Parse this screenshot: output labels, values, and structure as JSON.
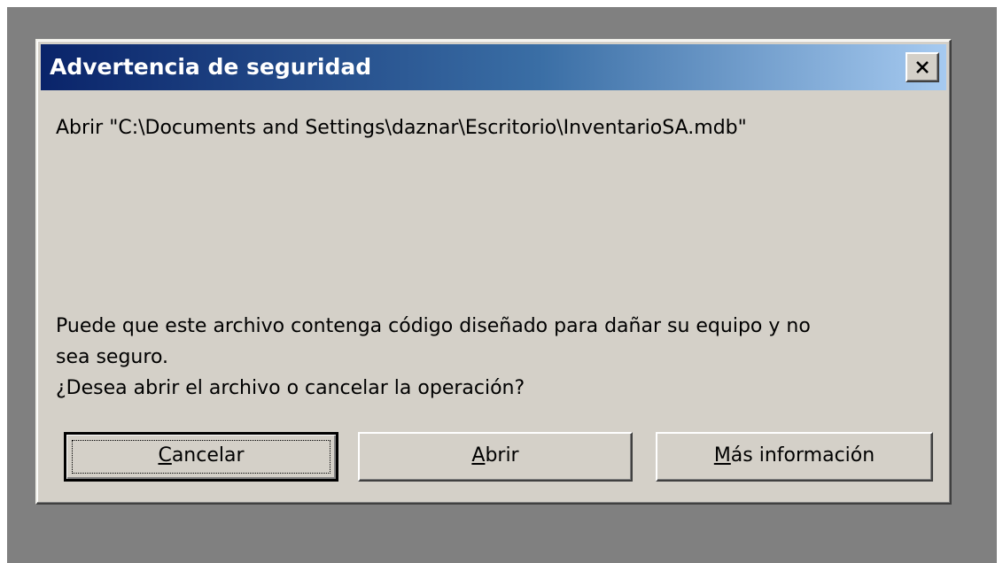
{
  "dialog": {
    "title": "Advertencia de seguridad",
    "close_glyph": "close-icon",
    "open_path_message": "Abrir \"C:\\Documents and Settings\\daznar\\Escritorio\\InventarioSA.mdb\"",
    "warning_line1": "Puede que este archivo contenga código diseñado para dañar su equipo y no",
    "warning_line2": "sea seguro.",
    "question": "¿Desea abrir el archivo o cancelar la operación?"
  },
  "buttons": {
    "cancel": {
      "mnemonic": "C",
      "rest": "ancelar"
    },
    "open": {
      "mnemonic": "A",
      "rest": "brir"
    },
    "more_info": {
      "mnemonic": "M",
      "rest": "ás información"
    }
  },
  "colors": {
    "desktop": "#808080",
    "dialog_face": "#d4d0c8",
    "titlebar_start": "#0a246a",
    "titlebar_end": "#a6caf0"
  }
}
